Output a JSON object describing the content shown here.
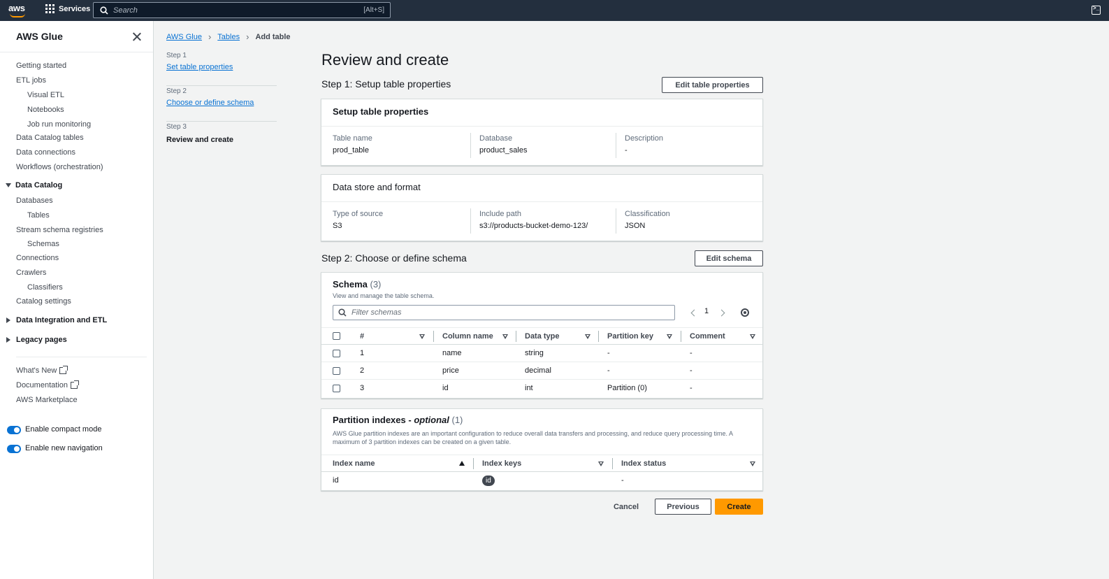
{
  "topnav": {
    "logo_text": "aws",
    "services_label": "Services",
    "search_placeholder": "Search",
    "search_shortcut": "[Alt+S]"
  },
  "sidebar": {
    "title": "AWS Glue",
    "items": [
      {
        "label": "Getting started"
      },
      {
        "label": "ETL jobs"
      },
      {
        "label": "Visual ETL"
      },
      {
        "label": "Notebooks"
      },
      {
        "label": "Job run monitoring"
      },
      {
        "label": "Data Catalog tables"
      },
      {
        "label": "Data connections"
      },
      {
        "label": "Workflows (orchestration)"
      }
    ],
    "data_catalog": {
      "label": "Data Catalog",
      "items": [
        {
          "label": "Databases"
        },
        {
          "label": "Tables"
        },
        {
          "label": "Stream schema registries"
        },
        {
          "label": "Schemas"
        },
        {
          "label": "Connections"
        },
        {
          "label": "Crawlers"
        },
        {
          "label": "Classifiers"
        },
        {
          "label": "Catalog settings"
        }
      ]
    },
    "data_integration_label": "Data Integration and ETL",
    "legacy_label": "Legacy pages",
    "whats_new": "What's New",
    "documentation": "Documentation",
    "marketplace": "AWS Marketplace",
    "compact_mode": "Enable compact mode",
    "new_navigation": "Enable new navigation"
  },
  "breadcrumb": {
    "items": [
      "AWS Glue",
      "Tables"
    ],
    "current": "Add table"
  },
  "steps": [
    {
      "number": "Step 1",
      "label": "Set table properties"
    },
    {
      "number": "Step 2",
      "label": "Choose or define schema"
    },
    {
      "number": "Step 3",
      "label": "Review and create"
    }
  ],
  "main": {
    "title": "Review and create",
    "step1_heading": "Step 1: Setup table properties",
    "edit_table_properties": "Edit table properties",
    "table_props_card": {
      "title": "Setup table properties",
      "fields": [
        {
          "label": "Table name",
          "value": "prod_table"
        },
        {
          "label": "Database",
          "value": "product_sales"
        },
        {
          "label": "Description",
          "value": "-"
        }
      ]
    },
    "data_store_card": {
      "title": "Data store and format",
      "fields": [
        {
          "label": "Type of source",
          "value": "S3"
        },
        {
          "label": "Include path",
          "value": "s3://products-bucket-demo-123/"
        },
        {
          "label": "Classification",
          "value": "JSON"
        }
      ]
    },
    "step2_heading": "Step 2: Choose or define schema",
    "edit_schema": "Edit schema",
    "schema": {
      "title": "Schema",
      "count": "(3)",
      "description": "View and manage the table schema.",
      "filter_placeholder": "Filter schemas",
      "page": "1",
      "columns": [
        "#",
        "Column name",
        "Data type",
        "Partition key",
        "Comment"
      ],
      "rows": [
        {
          "num": "1",
          "name": "name",
          "type": "string",
          "partition": "-",
          "comment": "-"
        },
        {
          "num": "2",
          "name": "price",
          "type": "decimal",
          "partition": "-",
          "comment": "-"
        },
        {
          "num": "3",
          "name": "id",
          "type": "int",
          "partition": "Partition (0)",
          "comment": "-"
        }
      ]
    },
    "partition_indexes": {
      "title": "Partition indexes - ",
      "title_italic": "optional",
      "count": "(1)",
      "description": "AWS Glue partition indexes are an important configuration to reduce overall data transfers and processing, and reduce query processing time. A maximum of 3 partition indexes can be created on a given table.",
      "columns": [
        "Index name",
        "Index keys",
        "Index status"
      ],
      "rows": [
        {
          "name": "id",
          "keys": "id",
          "status": "-"
        }
      ]
    },
    "cancel": "Cancel",
    "previous": "Previous",
    "create": "Create"
  },
  "colors": {
    "nav_bg": "#232f3e",
    "link": "#0972d3",
    "primary": "#ff9900"
  }
}
